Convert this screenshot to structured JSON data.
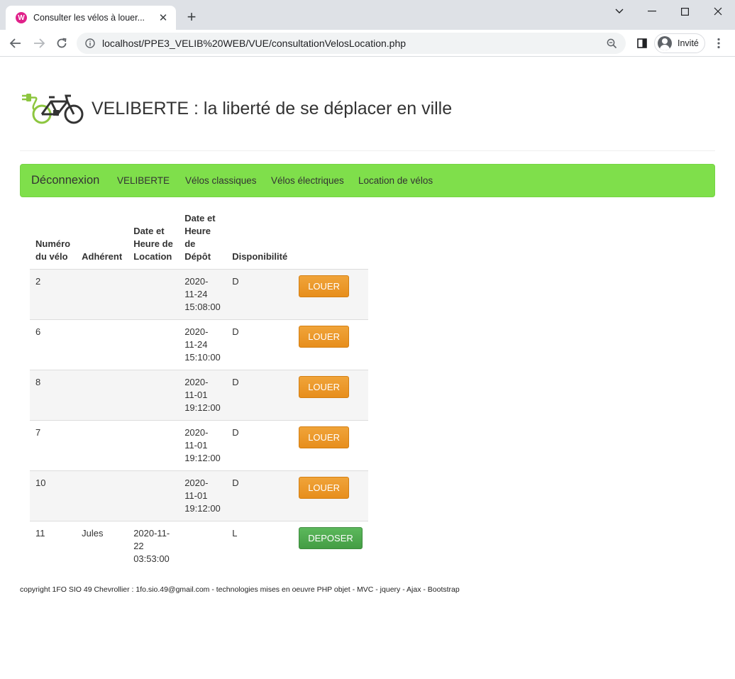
{
  "browser": {
    "tab_title": "Consulter les vélos à louer...",
    "favicon_letter": "W",
    "url": "localhost/PPE3_VELIB%20WEB/VUE/consultationVelosLocation.php",
    "profile_name": "Invité"
  },
  "header": {
    "title": "VELIBERTE : la liberté de se déplacer en ville"
  },
  "navbar": {
    "brand": "Déconnexion",
    "links": [
      "VELIBERTE",
      "Vélos classiques",
      "Vélos électriques",
      "Location de vélos"
    ]
  },
  "table": {
    "headers": [
      "Numéro du vélo",
      "Adhérent",
      "Date et Heure de Location",
      "Date et Heure de Dépôt",
      "Disponibilité",
      ""
    ],
    "rows": [
      {
        "numero": "2",
        "adherent": "",
        "date_location": "",
        "date_depot": "2020-11-24 15:08:00",
        "dispo": "D",
        "action": "LOUER"
      },
      {
        "numero": "6",
        "adherent": "",
        "date_location": "",
        "date_depot": "2020-11-24 15:10:00",
        "dispo": "D",
        "action": "LOUER"
      },
      {
        "numero": "8",
        "adherent": "",
        "date_location": "",
        "date_depot": "2020-11-01 19:12:00",
        "dispo": "D",
        "action": "LOUER"
      },
      {
        "numero": "7",
        "adherent": "",
        "date_location": "",
        "date_depot": "2020-11-01 19:12:00",
        "dispo": "D",
        "action": "LOUER"
      },
      {
        "numero": "10",
        "adherent": "",
        "date_location": "",
        "date_depot": "2020-11-01 19:12:00",
        "dispo": "D",
        "action": "LOUER"
      },
      {
        "numero": "11",
        "adherent": "Jules",
        "date_location": "2020-11-22 03:53:00",
        "date_depot": "",
        "dispo": "L",
        "action": "DEPOSER"
      }
    ]
  },
  "footer": {
    "text": "copyright 1FO SIO 49 Chevrollier : 1fo.sio.49@gmail.com - technologies mises en oeuvre PHP objet - MVC - jquery - Ajax - Bootstrap"
  },
  "colors": {
    "navbar_green": "#7fdf4b",
    "louer_orange": "#eb9a2e",
    "deposer_green": "#4cae4c",
    "logo_green": "#8dc63f"
  }
}
